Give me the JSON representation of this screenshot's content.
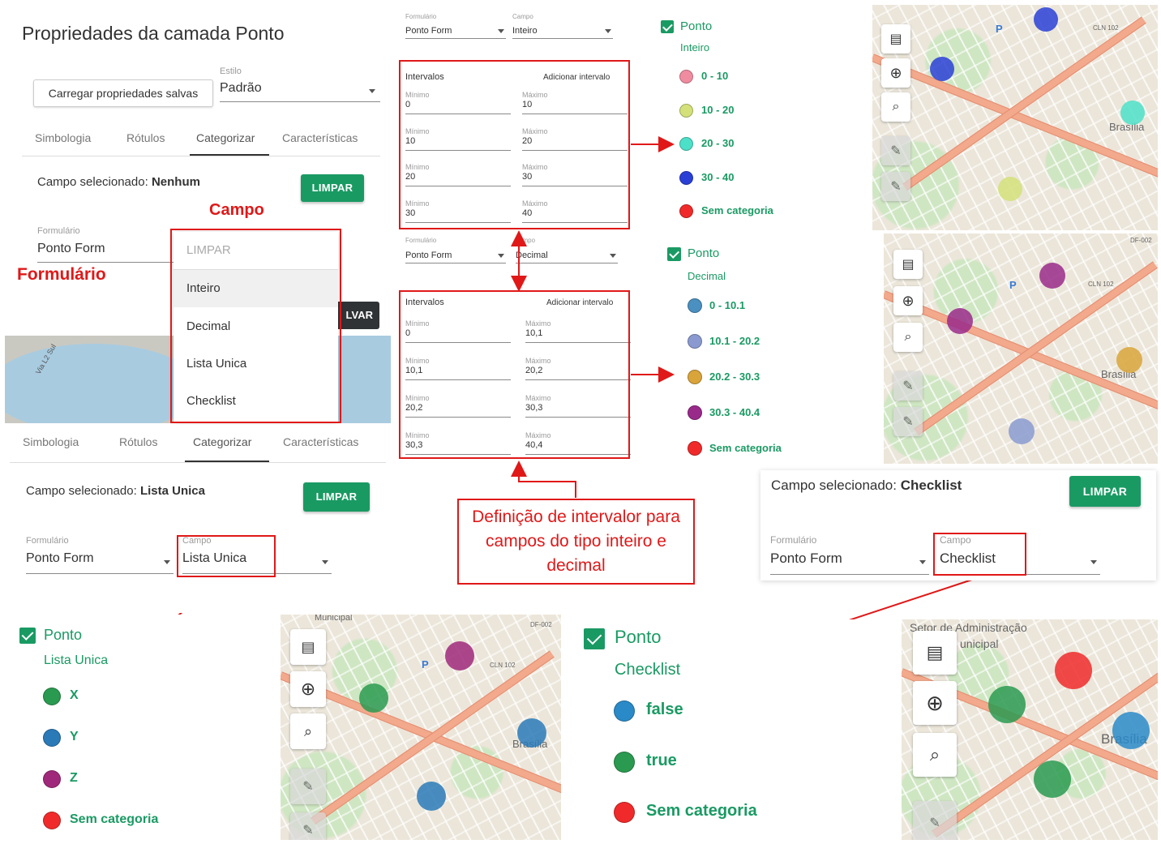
{
  "props_panel": {
    "title": "Propriedades da camada Ponto",
    "load_button": "Carregar propriedades salvas",
    "estilo_label": "Estilo",
    "estilo_value": "Padrão",
    "tabs": [
      "Simbologia",
      "Rótulos",
      "Categorizar",
      "Características"
    ],
    "selected_prefix": "Campo selecionado:",
    "selected_value": "Nenhum",
    "clear_button": "LIMPAR",
    "form_label": "Formulário",
    "form_value": "Ponto Form",
    "save_fragment": "LVAR",
    "map_street": "Via L2 Sul"
  },
  "field_dropdown": {
    "options": [
      "LIMPAR",
      "Inteiro",
      "Decimal",
      "Lista Unica",
      "Checklist"
    ]
  },
  "annotations": {
    "campo": "Campo",
    "formulario": "Formulário",
    "callout": "Definição de intervalor para campos do tipo inteiro e decimal"
  },
  "intervals_int": {
    "form_label": "Formulário",
    "form_value": "Ponto Form",
    "field_label": "Campo",
    "field_value": "Inteiro",
    "heading": "Intervalos",
    "add": "Adicionar intervalo",
    "min_label": "Mínimo",
    "max_label": "Máximo",
    "rows": [
      [
        "0",
        "10"
      ],
      [
        "10",
        "20"
      ],
      [
        "20",
        "30"
      ],
      [
        "30",
        "40"
      ]
    ]
  },
  "intervals_dec": {
    "form_label": "Formulário",
    "form_value": "Ponto Form",
    "field_label": "ampo",
    "field_value": "Decimal",
    "heading": "Intervalos",
    "add": "Adicionar intervalo",
    "min_label": "Mínimo",
    "max_label": "Máximo",
    "rows": [
      [
        "0",
        "10,1"
      ],
      [
        "10,1",
        "20,2"
      ],
      [
        "20,2",
        "30,3"
      ],
      [
        "30,3",
        "40,4"
      ]
    ]
  },
  "legend_int": {
    "layer": "Ponto",
    "field": "Inteiro",
    "items": [
      {
        "label": "0 - 10",
        "color": "#f08ca0"
      },
      {
        "label": "10 - 20",
        "color": "#d4e07a"
      },
      {
        "label": "20 - 30",
        "color": "#4de0c8"
      },
      {
        "label": "30 - 40",
        "color": "#2a3fd6"
      },
      {
        "label": "Sem categoria",
        "color": "#f02a2a"
      }
    ]
  },
  "legend_dec": {
    "layer": "Ponto",
    "field": "Decimal",
    "items": [
      {
        "label": "0 - 10.1",
        "color": "#4a90c0"
      },
      {
        "label": "10.1 - 20.2",
        "color": "#8a9ad0"
      },
      {
        "label": "20.2 - 30.3",
        "color": "#d9a43a"
      },
      {
        "label": "30.3 - 40.4",
        "color": "#9a2a8a"
      },
      {
        "label": "Sem categoria",
        "color": "#f02a2a"
      }
    ]
  },
  "legend_list": {
    "layer": "Ponto",
    "field": "Lista Unica",
    "items": [
      {
        "label": "X",
        "color": "#2a9a50"
      },
      {
        "label": "Y",
        "color": "#2a7ab8"
      },
      {
        "label": "Z",
        "color": "#a0287a"
      },
      {
        "label": "Sem categoria",
        "color": "#f02a2a"
      }
    ]
  },
  "legend_check": {
    "layer": "Ponto",
    "field": "Checklist",
    "items": [
      {
        "label": "false",
        "color": "#2a8ac8"
      },
      {
        "label": "true",
        "color": "#2a9a50"
      },
      {
        "label": "Sem categoria",
        "color": "#f02a2a"
      }
    ]
  },
  "list_panel": {
    "tabs": [
      "Simbologia",
      "Rótulos",
      "Categorizar",
      "Características"
    ],
    "selected_prefix": "Campo selecionado:",
    "selected_value": "Lista Unica",
    "clear_button": "LIMPAR",
    "form_label": "Formulário",
    "form_value": "Ponto Form",
    "field_label": "Campo",
    "field_value": "Lista Unica"
  },
  "check_panel": {
    "selected_prefix": "Campo selecionado:",
    "selected_value": "Checklist",
    "clear_button": "LIMPAR",
    "form_label": "Formulário",
    "form_value": "Ponto Form",
    "field_label": "Campo",
    "field_value": "Checklist"
  },
  "map_labels": {
    "brasilia": "Brasília",
    "cln": "CLN 102",
    "municipal": "Municipal",
    "df002": "DF-002",
    "setor": "Setor de Administração",
    "unicipal": "unicipal",
    "p": "P"
  },
  "icons": [
    "map-icon",
    "locate-icon",
    "zoom-select-icon",
    "pencil-icon"
  ]
}
